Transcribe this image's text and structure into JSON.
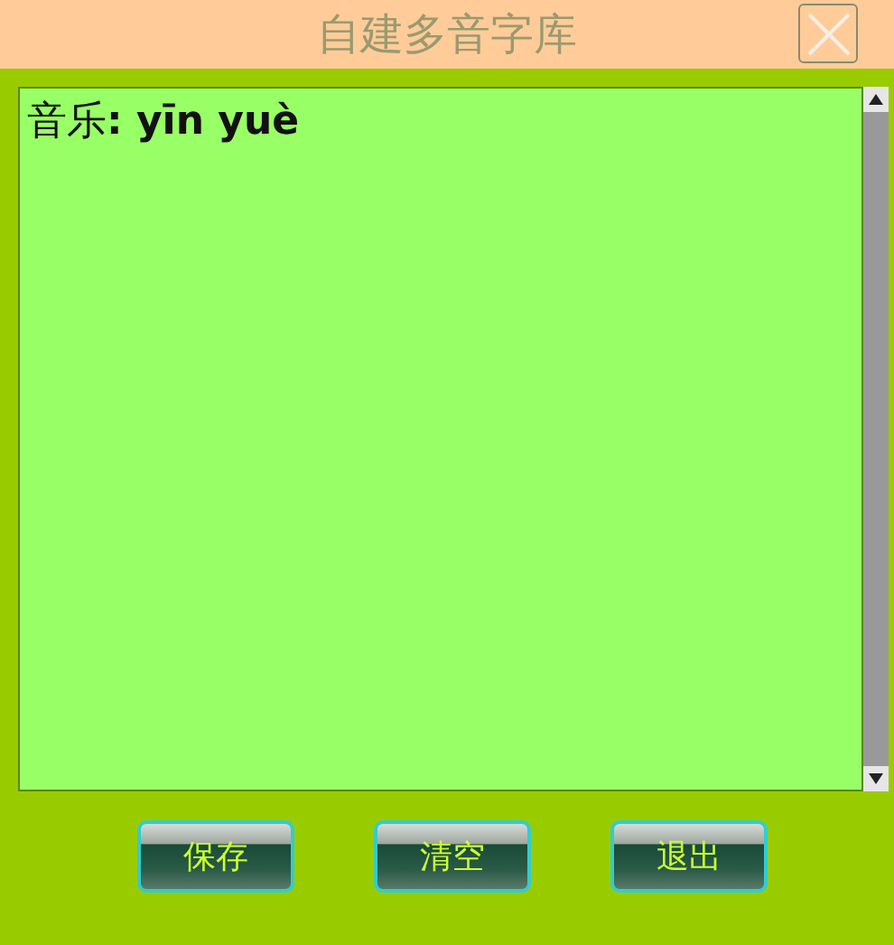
{
  "window": {
    "title": "自建多音字库"
  },
  "editor": {
    "content": "音乐**: yīn yuè**"
  },
  "buttons": [
    {
      "label": "保存"
    },
    {
      "label": "清空"
    },
    {
      "label": "退出"
    }
  ]
}
